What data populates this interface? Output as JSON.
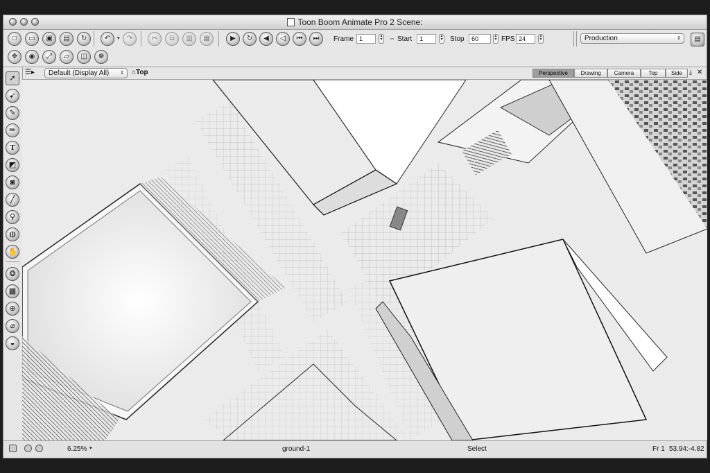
{
  "window": {
    "title": "Toon Boom Animate Pro 2 Scene:"
  },
  "toolbar": {
    "frame_label": "Frame",
    "frame_value": "1",
    "start_label": "Start",
    "start_value": "1",
    "stop_label": "Stop",
    "stop_value": "60",
    "fps_label": "FPS",
    "fps_value": "24",
    "workspace": "Production"
  },
  "view": {
    "display": "Default (Display All)",
    "current_view": "Top",
    "tabs": [
      "Perspective",
      "Drawing",
      "Camera",
      "Top",
      "Side"
    ],
    "active_tab": "Perspective"
  },
  "status": {
    "zoom": "6.25%",
    "drawing": "ground-1",
    "tool": "Select",
    "frame": "Fr 1",
    "coords": "53.94:-4.82"
  },
  "colors": {
    "chrome": "#e6e6e6",
    "backdrop": "#1d1d1d",
    "active_tab": "#9e9e9e"
  }
}
